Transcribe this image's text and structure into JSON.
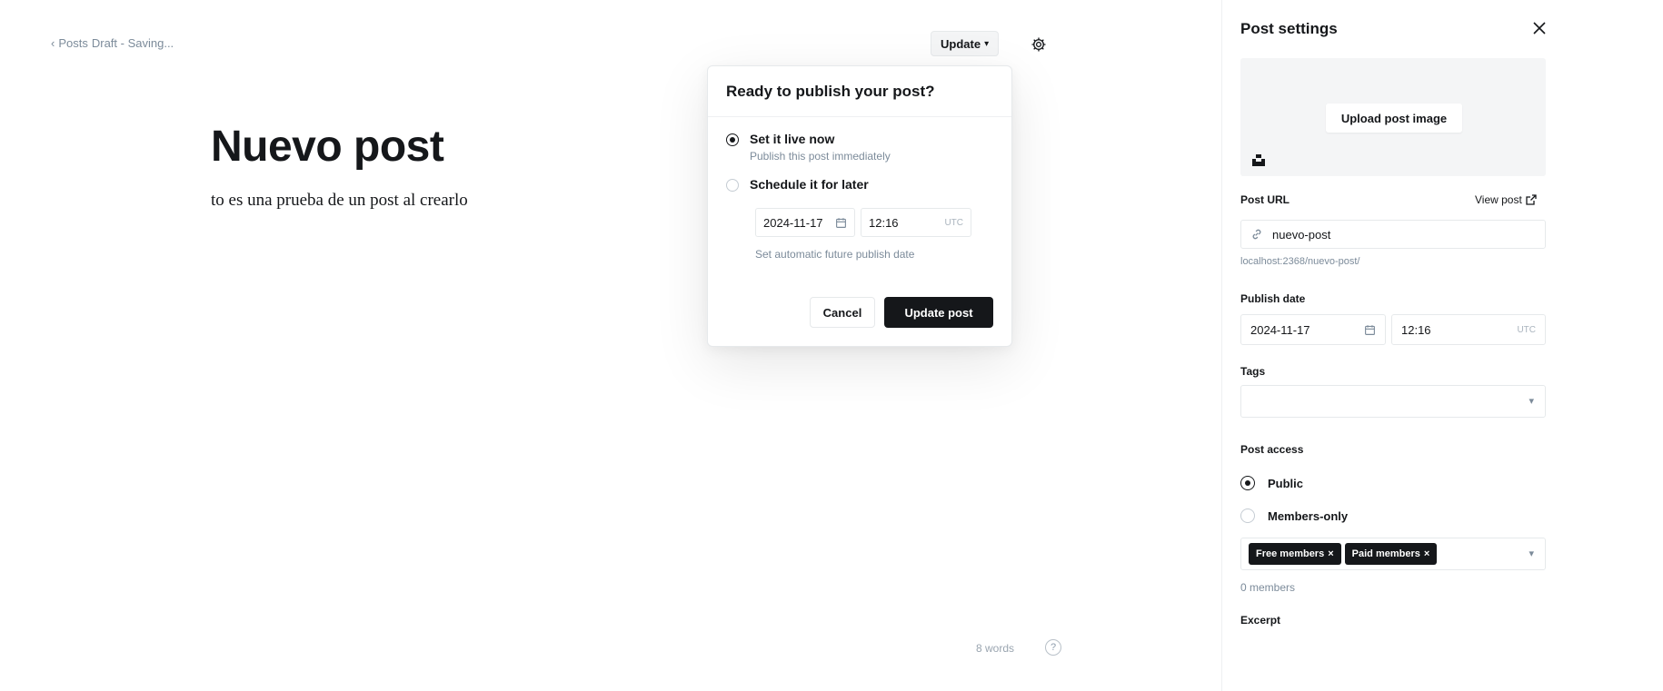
{
  "header": {
    "back_label": "Posts",
    "status_text": "Draft - Saving...",
    "update_label": "Update",
    "settings_icon": "gear-icon"
  },
  "editor": {
    "title": "Nuevo post",
    "body": "to es una prueba de un post al crearlo",
    "word_count": "8 words",
    "help": "?"
  },
  "publish_popover": {
    "title": "Ready to publish your post?",
    "option_now_label": "Set it live now",
    "option_now_desc": "Publish this post immediately",
    "option_later_label": "Schedule it for later",
    "date": "2024-11-17",
    "time": "12:16",
    "timezone": "UTC",
    "hint": "Set automatic future publish date",
    "cancel_label": "Cancel",
    "publish_label": "Update post"
  },
  "settings": {
    "title": "Post settings",
    "upload_label": "Upload post image",
    "post_url_label": "Post URL",
    "view_post_label": "View post",
    "slug": "nuevo-post",
    "url_hint": "localhost:2368/nuevo-post/",
    "publish_date_label": "Publish date",
    "publish_date": "2024-11-17",
    "publish_time": "12:16",
    "timezone": "UTC",
    "tags_label": "Tags",
    "access_label": "Post access",
    "access_public": "Public",
    "access_members": "Members-only",
    "chips": [
      "Free members",
      "Paid members"
    ],
    "members_count": "0 members",
    "excerpt_label": "Excerpt"
  },
  "colors": {
    "accent": "#15171a",
    "muted": "#7c8b9a",
    "border": "#e6e9eb"
  }
}
